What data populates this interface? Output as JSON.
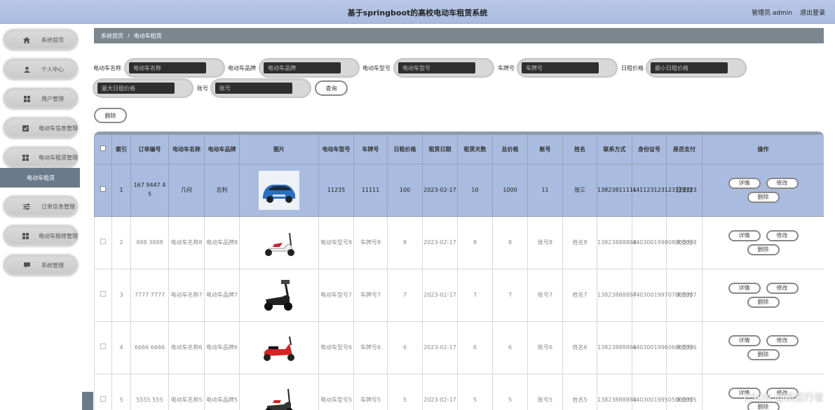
{
  "header": {
    "title": "基于springboot的高校电动车租赁系统",
    "user_label": "管理员 admin",
    "logout": "退出登录"
  },
  "sidebar": {
    "items": [
      {
        "label": "系统首页",
        "icon": "home-icon"
      },
      {
        "label": "个人中心",
        "icon": "person-icon"
      },
      {
        "label": "用户管理",
        "icon": "grid-icon"
      },
      {
        "label": "电动车信息管理",
        "icon": "check-icon"
      },
      {
        "label": "电动车租赁管理",
        "icon": "grid-icon"
      },
      {
        "label": "订单信息管理",
        "icon": "sliders-icon"
      },
      {
        "label": "电动车报修管理",
        "icon": "grid-icon"
      },
      {
        "label": "系统管理",
        "icon": "chat-icon"
      }
    ],
    "active_sub": "电动车租赁"
  },
  "breadcrumb": {
    "home": "系统首页",
    "sep": "/",
    "current": "电动车租赁"
  },
  "search": {
    "name_label": "电动车名称",
    "name_placeholder": "电动车名称",
    "brand_label": "电动车品牌",
    "brand_placeholder": "电动车品牌",
    "model_label": "电动车型号",
    "model_placeholder": "电动车型号",
    "plate_label": "车牌号",
    "plate_placeholder": "车牌号",
    "price_label": "日租价格",
    "min_placeholder": "最小日租价格",
    "max_placeholder": "最大日租价格",
    "account_label": "账号",
    "account_placeholder": "账号",
    "query": "查询",
    "delete": "删除"
  },
  "table": {
    "headers": [
      "索引",
      "订单编号",
      "电动车名称",
      "电动车品牌",
      "图片",
      "电动车型号",
      "车牌号",
      "日租价格",
      "租赁日期",
      "租赁天数",
      "总价格",
      "账号",
      "姓名",
      "联系方式",
      "身份证号",
      "是否支付",
      "操作"
    ],
    "ops": {
      "detail": "详情",
      "edit": "修改",
      "delete": "删除"
    },
    "rows": [
      {
        "idx": "1",
        "order": "167 9447 4 5",
        "name": "几何",
        "brand": "吉利",
        "model": "11235",
        "plate": "11111",
        "price": "100",
        "date": "2023-02-17",
        "days": "10",
        "total": "1000",
        "account": "11",
        "person": "张三",
        "phone": "13823811111",
        "idcard": "441123123123123123",
        "paid": "已支付",
        "image": "blue-car"
      },
      {
        "idx": "2",
        "order": "888 3888",
        "name": "电动车名称8",
        "brand": "电动车品牌8",
        "model": "电动车型号8",
        "plate": "车牌号8",
        "price": "8",
        "date": "2023-02-17",
        "days": "8",
        "total": "8",
        "account": "账号8",
        "person": "姓名8",
        "phone": "13823888888",
        "idcard": "440300199808000008",
        "paid": "未支付",
        "image": "white-scooter"
      },
      {
        "idx": "3",
        "order": "7777 7777",
        "name": "电动车名称7",
        "brand": "电动车品牌7",
        "model": "电动车型号7",
        "plate": "车牌号7",
        "price": "7",
        "date": "2023-02-17",
        "days": "7",
        "total": "7",
        "account": "账号7",
        "person": "姓名7",
        "phone": "13823888887",
        "idcard": "440300199707000007",
        "paid": "未支付",
        "image": "black-scooter"
      },
      {
        "idx": "4",
        "order": "6666 6666",
        "name": "电动车名称6",
        "brand": "电动车品牌6",
        "model": "电动车型号6",
        "plate": "车牌号6",
        "price": "6",
        "date": "2023-02-17",
        "days": "6",
        "total": "6",
        "account": "账号6",
        "person": "姓名6",
        "phone": "13823888886",
        "idcard": "440300199606000006",
        "paid": "未支付",
        "image": "red-scooter"
      },
      {
        "idx": "5",
        "order": "5555 555",
        "name": "电动车名称5",
        "brand": "电动车品牌5",
        "model": "电动车型号5",
        "plate": "车牌号5",
        "price": "5",
        "date": "2023-02-17",
        "days": "5",
        "total": "5",
        "account": "账号5",
        "person": "姓名5",
        "phone": "13823888885",
        "idcard": "440300199505000005",
        "paid": "未支付",
        "image": "dark-scooter"
      }
    ]
  },
  "watermark": "CSDN @疯狂行者"
}
